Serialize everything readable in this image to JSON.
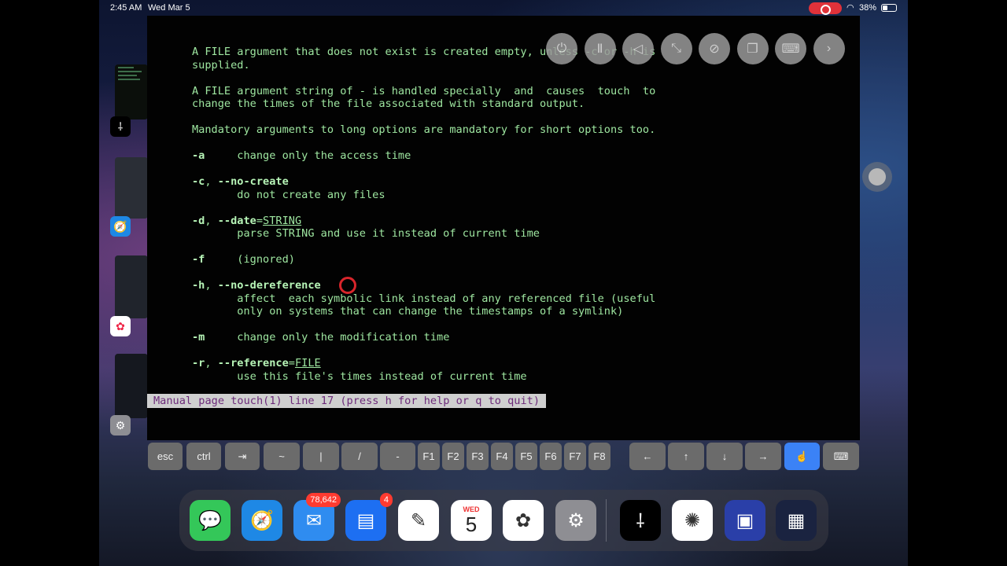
{
  "status_bar": {
    "time": "2:45 AM",
    "date": "Wed Mar 5",
    "battery": "38%"
  },
  "man_page": {
    "lines": [
      [
        {
          "t": "A FILE argument that does not exist is created empty, unless -c or -h is"
        }
      ],
      [
        {
          "t": "supplied."
        }
      ],
      [
        {
          "t": ""
        }
      ],
      [
        {
          "t": "A FILE argument string of - is handled specially  and  causes  touch  to"
        }
      ],
      [
        {
          "t": "change the times of the file associated with standard output."
        }
      ],
      [
        {
          "t": ""
        }
      ],
      [
        {
          "t": "Mandatory arguments to long options are mandatory for short options too."
        }
      ],
      [
        {
          "t": ""
        }
      ],
      [
        {
          "t": "-a",
          "s": "b"
        },
        {
          "t": "     change only the access time"
        }
      ],
      [
        {
          "t": ""
        }
      ],
      [
        {
          "t": "-c",
          "s": "b"
        },
        {
          "t": ", "
        },
        {
          "t": "--no-create",
          "s": "b"
        }
      ],
      [
        {
          "t": "       do not create any files"
        }
      ],
      [
        {
          "t": ""
        }
      ],
      [
        {
          "t": "-d",
          "s": "b"
        },
        {
          "t": ", "
        },
        {
          "t": "--date",
          "s": "b"
        },
        {
          "t": "="
        },
        {
          "t": "STRING",
          "s": "u"
        }
      ],
      [
        {
          "t": "       parse STRING and use it instead of current time"
        }
      ],
      [
        {
          "t": ""
        }
      ],
      [
        {
          "t": "-f",
          "s": "b"
        },
        {
          "t": "     (ignored)"
        }
      ],
      [
        {
          "t": ""
        }
      ],
      [
        {
          "t": "-h",
          "s": "b"
        },
        {
          "t": ", "
        },
        {
          "t": "--no-dereference",
          "s": "b"
        }
      ],
      [
        {
          "t": "       affect  each symbolic link instead of any referenced file (useful"
        }
      ],
      [
        {
          "t": "       only on systems that can change the timestamps of a symlink)"
        }
      ],
      [
        {
          "t": ""
        }
      ],
      [
        {
          "t": "-m",
          "s": "b"
        },
        {
          "t": "     change only the modification time"
        }
      ],
      [
        {
          "t": ""
        }
      ],
      [
        {
          "t": "-r",
          "s": "b"
        },
        {
          "t": ", "
        },
        {
          "t": "--reference",
          "s": "b"
        },
        {
          "t": "="
        },
        {
          "t": "FILE",
          "s": "u"
        }
      ],
      [
        {
          "t": "       use this file's times instead of current time"
        }
      ]
    ],
    "pager_status": "Manual page touch(1) line 17 (press h for help or q to quit)"
  },
  "toolbar": {
    "buttons": [
      {
        "name": "power-icon",
        "glyph": "⏻"
      },
      {
        "name": "pause-icon",
        "glyph": "Ⅱ"
      },
      {
        "name": "back-triangle-icon",
        "glyph": "◁"
      },
      {
        "name": "expand-icon",
        "glyph": "⤡"
      },
      {
        "name": "pin-icon",
        "glyph": "⊘"
      },
      {
        "name": "windows-icon",
        "glyph": "❐"
      },
      {
        "name": "keyboard-icon",
        "glyph": "⌨"
      },
      {
        "name": "chevron-right-icon",
        "glyph": "›"
      }
    ]
  },
  "keys": [
    {
      "name": "key-esc",
      "label": "esc"
    },
    {
      "name": "key-ctrl",
      "label": "ctrl"
    },
    {
      "name": "key-tab",
      "label": "⇥"
    },
    {
      "name": "key-tilde",
      "label": "~"
    },
    {
      "name": "key-pipe",
      "label": "|"
    },
    {
      "name": "key-slash",
      "label": "/"
    },
    {
      "name": "key-dash",
      "label": "-"
    },
    {
      "name": "key-f1",
      "label": "F1"
    },
    {
      "name": "key-f2",
      "label": "F2"
    },
    {
      "name": "key-f3",
      "label": "F3"
    },
    {
      "name": "key-f4",
      "label": "F4"
    },
    {
      "name": "key-f5",
      "label": "F5"
    },
    {
      "name": "key-f6",
      "label": "F6"
    },
    {
      "name": "key-f7",
      "label": "F7"
    },
    {
      "name": "key-f8",
      "label": "F8"
    },
    {
      "name": "key-left",
      "label": "←"
    },
    {
      "name": "key-up",
      "label": "↑"
    },
    {
      "name": "key-down",
      "label": "↓"
    },
    {
      "name": "key-right",
      "label": "→"
    },
    {
      "name": "key-touch-mode",
      "label": "☝"
    },
    {
      "name": "key-keyboard",
      "label": "⌨"
    }
  ],
  "dock": {
    "apps": [
      {
        "name": "messages-app",
        "glyph": "💬",
        "color": "#34c759"
      },
      {
        "name": "safari-app",
        "glyph": "🧭",
        "color": "#1e88e5"
      },
      {
        "name": "mail-app",
        "glyph": "✉",
        "color": "#2f8cf0",
        "badge": "78,642"
      },
      {
        "name": "news-app",
        "glyph": "▤",
        "color": "#1d6ff2",
        "badge": "4"
      },
      {
        "name": "freeform-app",
        "glyph": "✎",
        "color": "#ffffff"
      },
      {
        "name": "calendar-app",
        "glyph": "",
        "color": "#ffffff",
        "weekday": "WED",
        "day": "5"
      },
      {
        "name": "photos-app",
        "glyph": "✿",
        "color": "#ffffff"
      },
      {
        "name": "settings-app",
        "glyph": "⚙",
        "color": "#8e8e93"
      },
      {
        "name": "terminal-app",
        "glyph": "⸸",
        "color": "#000000"
      },
      {
        "name": "chatgpt-app",
        "glyph": "✺",
        "color": "#ffffff"
      },
      {
        "name": "screens-app",
        "glyph": "▣",
        "color": "#2a3fa8"
      },
      {
        "name": "app-library",
        "glyph": "▦",
        "color": "#1a2340"
      }
    ]
  }
}
